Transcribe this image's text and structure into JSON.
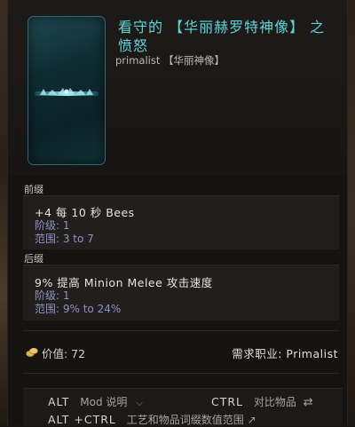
{
  "item": {
    "title": "看守的 【华丽赫罗特神像】 之愤怒",
    "subtitle": "primalist 【华丽神像】"
  },
  "prefix": {
    "label": "前缀",
    "main": "+4 每 10 秒 Bees",
    "tier": "阶级: 1",
    "range": "范围: 3 to 7"
  },
  "suffix": {
    "label": "后缀",
    "main": "9% 提高 Minion Melee 攻击速度",
    "tier": "阶级: 1",
    "range": "范围: 9% to 24%"
  },
  "footer": {
    "value": "价值: 72",
    "requirement": "需求职业: Primalist"
  },
  "hints": {
    "alt_key": "ALT",
    "alt_label": "Mod 说明",
    "ctrl_key": "CTRL",
    "ctrl_label": "对比物品",
    "altctrl_key": "ALT +CTRL",
    "altctrl_label": "工艺和物品词缀数值范围"
  },
  "colors": {
    "title": "#59d6dc",
    "tier_range": "#8c93c9",
    "background": "#151311"
  },
  "icons": {
    "coin": "coin-icon",
    "dropdown": "chevron-down-icon",
    "compare": "swap-icon",
    "external": "arrow-up-right-icon"
  }
}
